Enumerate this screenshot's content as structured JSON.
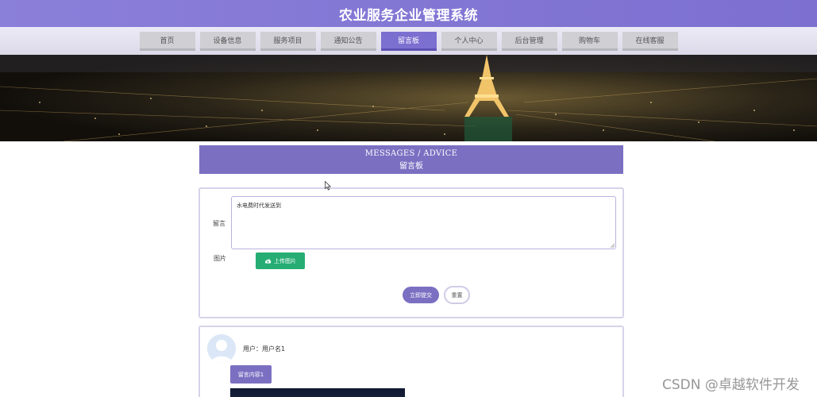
{
  "header": {
    "title": "农业服务企业管理系统"
  },
  "nav": {
    "items": [
      {
        "label": "首页"
      },
      {
        "label": "设备信息"
      },
      {
        "label": "服务项目"
      },
      {
        "label": "通知公告"
      },
      {
        "label": "留言板"
      },
      {
        "label": "个人中心"
      },
      {
        "label": "后台管理"
      },
      {
        "label": "购物车"
      },
      {
        "label": "在线客服"
      }
    ],
    "active_index": 4
  },
  "section": {
    "title_en": "MESSAGES / ADVICE",
    "title_cn": "留言板"
  },
  "form": {
    "message_label": "留言",
    "message_value": "水电费时代发送到",
    "image_label": "图片",
    "upload_label": "上传图片",
    "submit_label": "立即提交",
    "reset_label": "重置"
  },
  "comments": [
    {
      "user": "用户：用户名1",
      "content_label": "留言内容1"
    }
  ],
  "colors": {
    "accent": "#7b6fc2",
    "upload": "#26ad74",
    "header": "#8a7fd9"
  },
  "watermark": "CSDN @卓越软件开发"
}
